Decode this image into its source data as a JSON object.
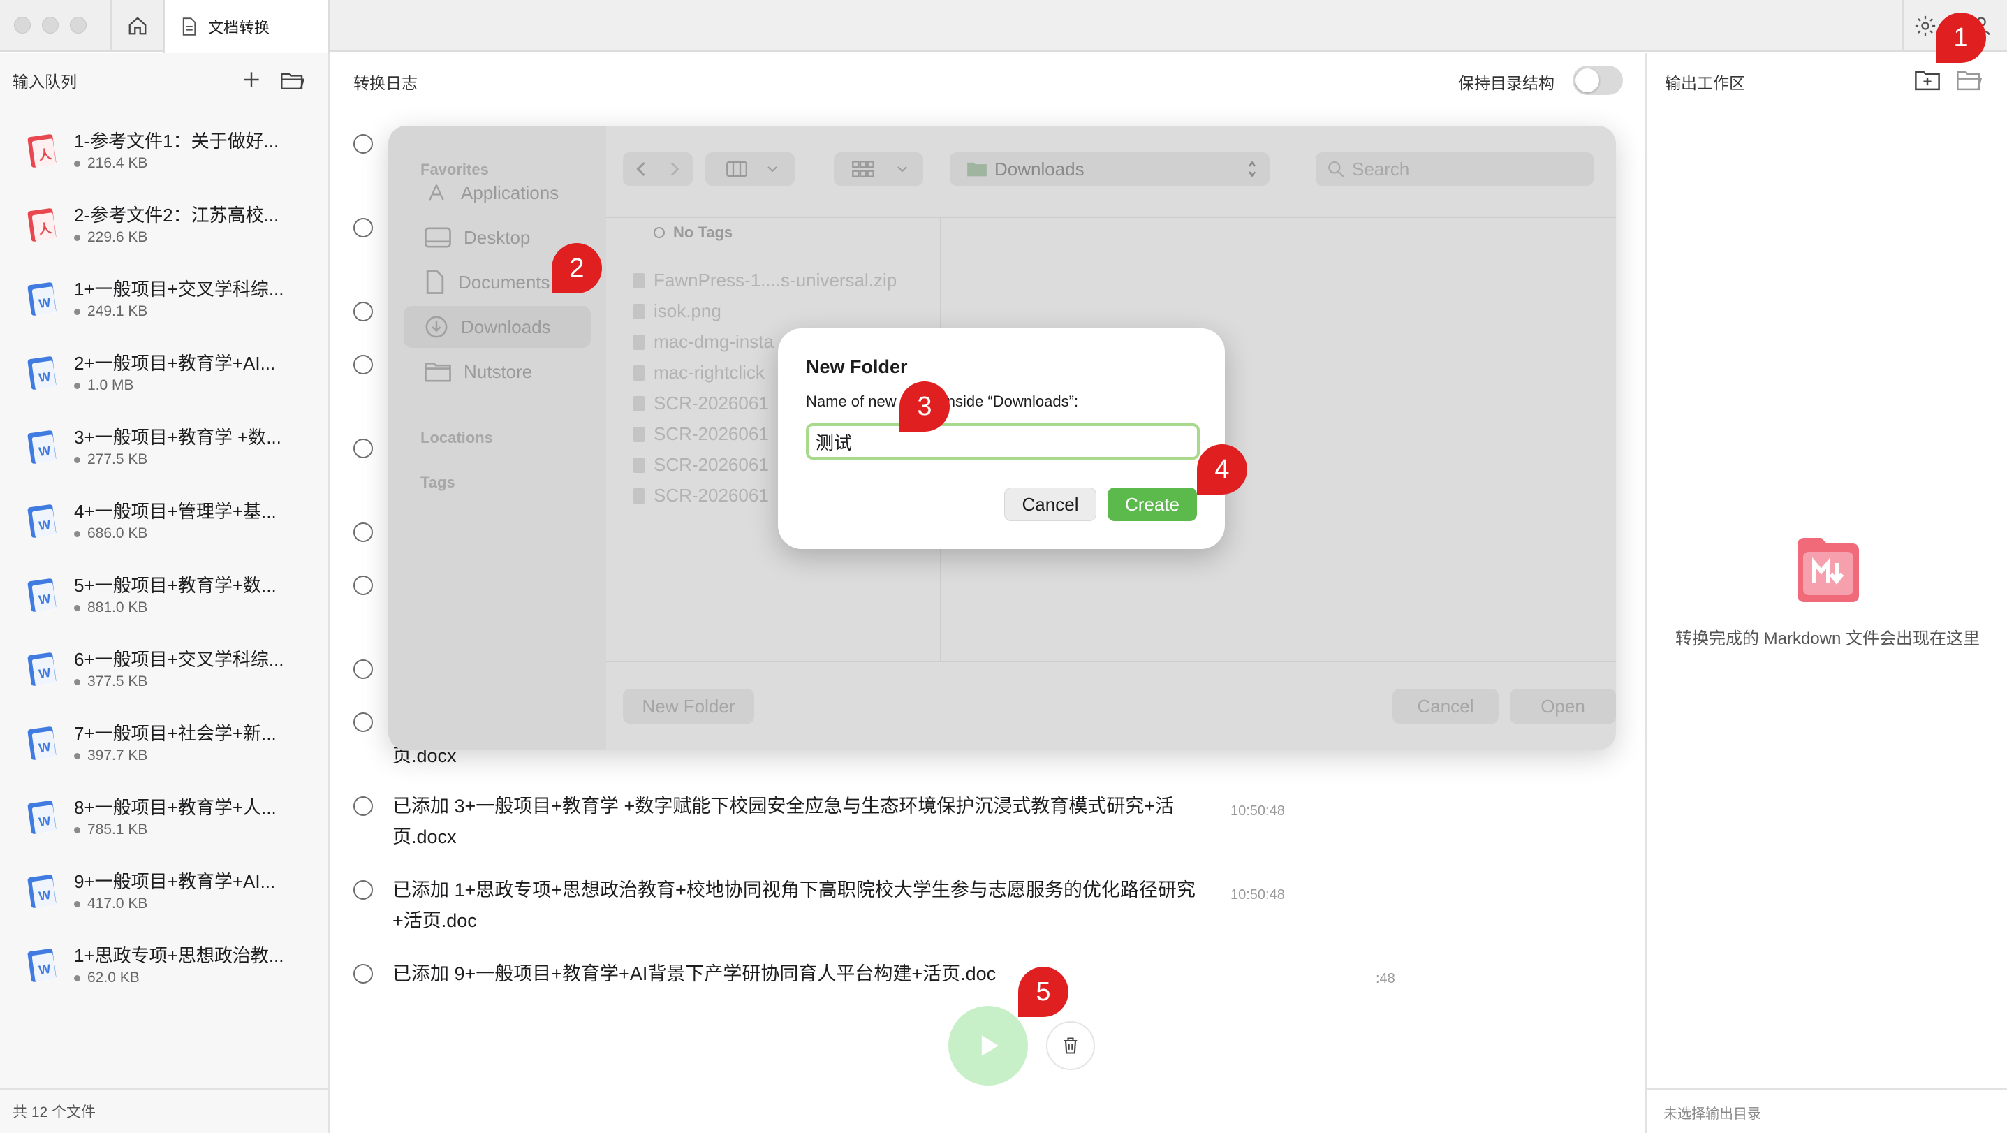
{
  "window": {
    "tab_title": "文档转换"
  },
  "input_queue": {
    "title": "输入队列",
    "files": [
      {
        "name": "1-参考文件1：关于做好...",
        "size": "216.4 KB",
        "type": "pdf"
      },
      {
        "name": "2-参考文件2：江苏高校...",
        "size": "229.6 KB",
        "type": "pdf"
      },
      {
        "name": "1+一般项目+交叉学科综...",
        "size": "249.1 KB",
        "type": "word"
      },
      {
        "name": "2+一般项目+教育学+AI...",
        "size": "1.0 MB",
        "type": "word"
      },
      {
        "name": "3+一般项目+教育学 +数...",
        "size": "277.5 KB",
        "type": "word"
      },
      {
        "name": "4+一般项目+管理学+基...",
        "size": "686.0 KB",
        "type": "word"
      },
      {
        "name": "5+一般项目+教育学+数...",
        "size": "881.0 KB",
        "type": "word"
      },
      {
        "name": "6+一般项目+交叉学科综...",
        "size": "377.5 KB",
        "type": "word"
      },
      {
        "name": "7+一般项目+社会学+新...",
        "size": "397.7 KB",
        "type": "word"
      },
      {
        "name": "8+一般项目+教育学+人...",
        "size": "785.1 KB",
        "type": "word"
      },
      {
        "name": "9+一般项目+教育学+AI...",
        "size": "417.0 KB",
        "type": "word"
      },
      {
        "name": "1+思政专项+思想政治教...",
        "size": "62.0 KB",
        "type": "word"
      }
    ],
    "footer": "共 12 个文件"
  },
  "log": {
    "title": "转换日志",
    "keep_structure_label": "保持目录结构",
    "keep_structure_on": false,
    "entries": [
      {
        "line1": "页.docx",
        "line2": "",
        "time": ""
      },
      {
        "line1": "已添加 3+一般项目+教育学 +数字赋能下校园安全应急与生态环境保护沉浸式教育模式研究+活",
        "line2": "页.docx",
        "time": "10:50:48"
      },
      {
        "line1": "已添加 1+思政专项+思想政治教育+校地协同视角下高职院校大学生参与志愿服务的优化路径研究",
        "line2": "+活页.doc",
        "time": "10:50:48"
      },
      {
        "line1": "已添加 9+一般项目+教育学+AI背景下产学研协同育人平台构建+活页.doc",
        "line2": "",
        "time": ":48"
      }
    ]
  },
  "output": {
    "title": "输出工作区",
    "empty_text": "转换完成的 Markdown 文件会出现在这里",
    "footer": "未选择输出目录"
  },
  "file_sheet": {
    "favorites_label": "Favorites",
    "sidebar_items": [
      "Applications",
      "Desktop",
      "Documents",
      "Downloads",
      "Nutstore"
    ],
    "locations_label": "Locations",
    "tags_label": "Tags",
    "path": "Downloads",
    "search_placeholder": "Search",
    "no_tags": "No Tags",
    "files": [
      "FawnPress-1....s-universal.zip",
      "isok.png",
      "mac-dmg-insta",
      "mac-rightclick",
      "SCR-2026061",
      "SCR-2026061",
      "SCR-2026061",
      "SCR-2026061"
    ],
    "new_folder_button": "New Folder",
    "cancel_button": "Cancel",
    "open_button": "Open"
  },
  "new_folder_dialog": {
    "title": "New Folder",
    "label": "Name of new folder inside “Downloads”:",
    "value": "测试",
    "cancel": "Cancel",
    "create": "Create"
  },
  "markers": [
    "1",
    "2",
    "3",
    "4",
    "5"
  ],
  "colors": {
    "accent_green": "#5cb94c",
    "play_green": "#c8f0c8",
    "marker_red": "#e02020",
    "pdf_red": "#e8474f",
    "word_blue": "#3f7be0"
  }
}
